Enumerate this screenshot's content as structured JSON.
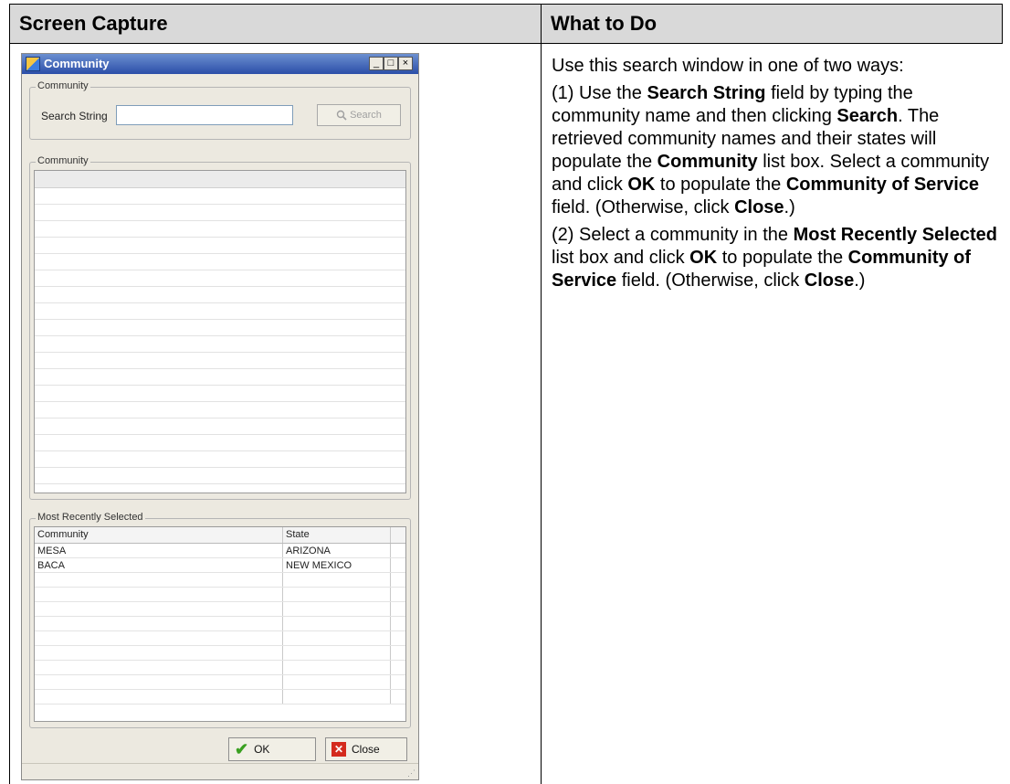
{
  "header": {
    "col1": "Screen Capture",
    "col2": "What to Do"
  },
  "window": {
    "title": "Community",
    "minimize": "_",
    "maximize": "□",
    "close": "×",
    "search_group": {
      "legend": "Community",
      "label": "Search String",
      "value": "",
      "button": "Search"
    },
    "list_group": {
      "legend": "Community"
    },
    "recent_group": {
      "legend": "Most Recently Selected",
      "columns": [
        "Community",
        "State"
      ],
      "rows": [
        {
          "community": "MESA",
          "state": "ARIZONA"
        },
        {
          "community": "BACA",
          "state": "NEW MEXICO"
        }
      ]
    },
    "ok_label": "OK",
    "close_label": "Close"
  },
  "instructions": {
    "p1": "Use this search window in one of two ways:",
    "p2": {
      "t1": "(1) Use the ",
      "b1": "Search String",
      "t2": " field by typing the community name and then clicking ",
      "b2": "Search",
      "t3": ". The retrieved community names and their states will populate the ",
      "b3": "Community",
      "t4": " list box. Select a community and click ",
      "b4": "OK",
      "t5": " to populate the ",
      "b5": "Community of Service",
      "t6": " field. (Otherwise, click ",
      "b6": "Close",
      "t7": ".)"
    },
    "p3": {
      "t1": "(2) Select a community in the ",
      "b1": "Most Recently Selected",
      "t2": " list box and click ",
      "b2": "OK",
      "t3": " to populate the ",
      "b3": "Community of Service",
      "t4": " field. (Otherwise, click ",
      "b4": "Close",
      "t5": ".)"
    }
  }
}
